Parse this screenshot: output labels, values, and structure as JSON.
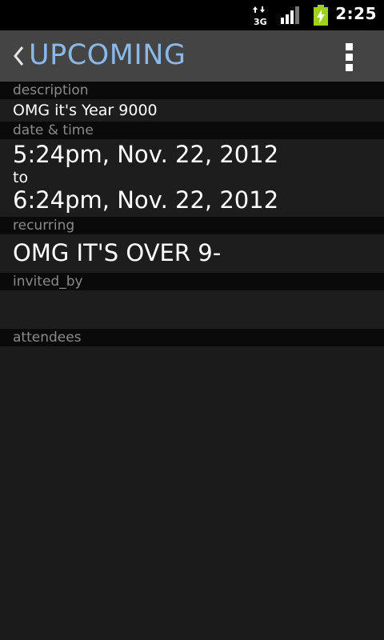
{
  "status_bar": {
    "network_type": "3G",
    "time": "2:25"
  },
  "action_bar": {
    "title": "UPCOMING"
  },
  "event": {
    "description_label": "description",
    "description_value": "OMG it's Year 9000",
    "datetime_label": "date & time",
    "start": "5:24pm, Nov. 22, 2012",
    "to_text": "to",
    "end": "6:24pm, Nov. 22, 2012",
    "recurring_label": "recurring",
    "recurring_value": "OMG IT'S OVER 9-",
    "invited_by_label": "invited_by",
    "invited_by_value": "",
    "attendees_label": "attendees"
  },
  "colors": {
    "title_color": "#8cb8e8",
    "battery_color": "#9fd01c",
    "label_color": "#8a8a8a"
  },
  "icons": [
    "back-chevron-icon",
    "overflow-menu-icon",
    "network-3g-icon",
    "signal-strength-icon",
    "battery-charging-icon"
  ]
}
